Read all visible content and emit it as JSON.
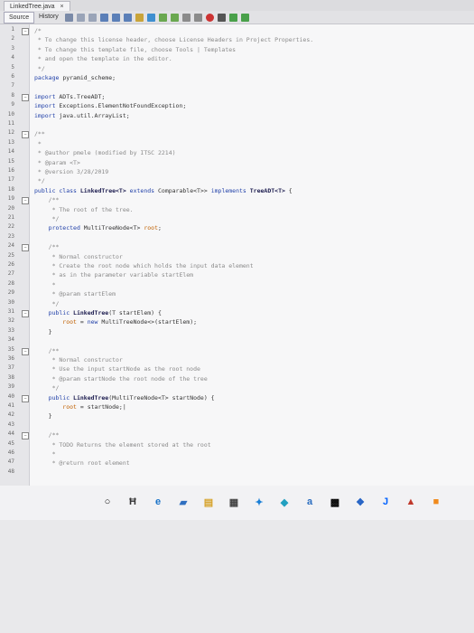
{
  "tab": {
    "title": "LinkedTree.java",
    "close": "×"
  },
  "view_tabs": [
    "Source",
    "History"
  ],
  "code_lines": [
    {
      "n": "1",
      "segs": [
        {
          "c": "cm",
          "t": "/*"
        }
      ]
    },
    {
      "n": "2",
      "segs": [
        {
          "c": "cm",
          "t": " * To change this license header, choose License Headers in Project Properties."
        }
      ]
    },
    {
      "n": "3",
      "segs": [
        {
          "c": "cm",
          "t": " * To change this template file, choose Tools | Templates"
        }
      ]
    },
    {
      "n": "4",
      "segs": [
        {
          "c": "cm",
          "t": " * and open the template in the editor."
        }
      ]
    },
    {
      "n": "5",
      "segs": [
        {
          "c": "cm",
          "t": " */"
        }
      ]
    },
    {
      "n": "6",
      "segs": [
        {
          "c": "kw",
          "t": "package"
        },
        {
          "c": "",
          "t": " pyramid_scheme;"
        }
      ]
    },
    {
      "n": "7",
      "segs": []
    },
    {
      "n": "8",
      "segs": [
        {
          "c": "kw",
          "t": "import"
        },
        {
          "c": "",
          "t": " ADTs.TreeADT;"
        }
      ]
    },
    {
      "n": "9",
      "segs": [
        {
          "c": "kw",
          "t": "import"
        },
        {
          "c": "",
          "t": " Exceptions.ElementNotFoundException;"
        }
      ]
    },
    {
      "n": "10",
      "segs": [
        {
          "c": "kw",
          "t": "import"
        },
        {
          "c": "",
          "t": " java.util.ArrayList;"
        }
      ]
    },
    {
      "n": "11",
      "segs": []
    },
    {
      "n": "12",
      "segs": [
        {
          "c": "cm",
          "t": "/**"
        }
      ]
    },
    {
      "n": "13",
      "segs": [
        {
          "c": "cm",
          "t": " *"
        }
      ]
    },
    {
      "n": "14",
      "segs": [
        {
          "c": "cm",
          "t": " * @author pmele (modified by ITSC 2214)"
        }
      ]
    },
    {
      "n": "15",
      "segs": [
        {
          "c": "cm",
          "t": " * @param <T>"
        }
      ]
    },
    {
      "n": "16",
      "segs": [
        {
          "c": "cm",
          "t": " * @version 3/28/2019"
        }
      ]
    },
    {
      "n": "17",
      "segs": [
        {
          "c": "cm",
          "t": " */"
        }
      ]
    },
    {
      "n": "18",
      "segs": [
        {
          "c": "kw",
          "t": "public class"
        },
        {
          "c": "ty",
          "t": " LinkedTree<T>"
        },
        {
          "c": "kw",
          "t": " extends"
        },
        {
          "c": "",
          "t": " Comparable<T>> "
        },
        {
          "c": "kw",
          "t": "implements"
        },
        {
          "c": "ty",
          "t": " TreeADT<T>"
        },
        {
          "c": "",
          "t": " {"
        }
      ]
    },
    {
      "n": "19",
      "segs": [
        {
          "c": "cm",
          "t": "    /**"
        }
      ]
    },
    {
      "n": "20",
      "segs": [
        {
          "c": "cm",
          "t": "     * The root of the tree."
        }
      ]
    },
    {
      "n": "21",
      "segs": [
        {
          "c": "cm",
          "t": "     */"
        }
      ]
    },
    {
      "n": "22",
      "segs": [
        {
          "c": "kw",
          "t": "    protected"
        },
        {
          "c": "",
          "t": " MultiTreeNode<T> "
        },
        {
          "c": "ps",
          "t": "root"
        },
        {
          "c": "",
          "t": ";"
        }
      ]
    },
    {
      "n": "23",
      "segs": []
    },
    {
      "n": "24",
      "segs": [
        {
          "c": "cm",
          "t": "    /**"
        }
      ]
    },
    {
      "n": "25",
      "segs": [
        {
          "c": "cm",
          "t": "     * Normal constructor"
        }
      ]
    },
    {
      "n": "26",
      "segs": [
        {
          "c": "cm",
          "t": "     * Create the root node which holds the input data element"
        }
      ]
    },
    {
      "n": "27",
      "segs": [
        {
          "c": "cm",
          "t": "     * as in the parameter variable startElem"
        }
      ]
    },
    {
      "n": "28",
      "segs": [
        {
          "c": "cm",
          "t": "     *"
        }
      ]
    },
    {
      "n": "29",
      "segs": [
        {
          "c": "cm",
          "t": "     * @param startElem"
        }
      ]
    },
    {
      "n": "30",
      "segs": [
        {
          "c": "cm",
          "t": "     */"
        }
      ]
    },
    {
      "n": "31",
      "segs": [
        {
          "c": "kw",
          "t": "    public"
        },
        {
          "c": "ty",
          "t": " LinkedTree"
        },
        {
          "c": "",
          "t": "(T startElem) {"
        }
      ]
    },
    {
      "n": "32",
      "segs": [
        {
          "c": "ps",
          "t": "        root"
        },
        {
          "c": "",
          "t": " = "
        },
        {
          "c": "kw",
          "t": "new"
        },
        {
          "c": "",
          "t": " MultiTreeNode<>(startElem);"
        }
      ]
    },
    {
      "n": "33",
      "segs": [
        {
          "c": "",
          "t": "    }"
        }
      ]
    },
    {
      "n": "34",
      "segs": []
    },
    {
      "n": "35",
      "segs": [
        {
          "c": "cm",
          "t": "    /**"
        }
      ]
    },
    {
      "n": "36",
      "segs": [
        {
          "c": "cm",
          "t": "     * Normal constructor"
        }
      ]
    },
    {
      "n": "37",
      "segs": [
        {
          "c": "cm",
          "t": "     * Use the input startNode as the root node"
        }
      ]
    },
    {
      "n": "38",
      "segs": [
        {
          "c": "cm",
          "t": "     * @param startNode the root node of the tree"
        }
      ]
    },
    {
      "n": "39",
      "segs": [
        {
          "c": "cm",
          "t": "     */"
        }
      ]
    },
    {
      "n": "40",
      "segs": [
        {
          "c": "kw",
          "t": "    public"
        },
        {
          "c": "ty",
          "t": " LinkedTree"
        },
        {
          "c": "",
          "t": "(MultiTreeNode<T> startNode) {"
        }
      ]
    },
    {
      "n": "41",
      "segs": [
        {
          "c": "ps",
          "t": "        root"
        },
        {
          "c": "",
          "t": " = startNode;|"
        }
      ]
    },
    {
      "n": "42",
      "segs": [
        {
          "c": "",
          "t": "    }"
        }
      ]
    },
    {
      "n": "43",
      "segs": []
    },
    {
      "n": "44",
      "segs": [
        {
          "c": "cm",
          "t": "    /**"
        }
      ]
    },
    {
      "n": "45",
      "segs": [
        {
          "c": "cm",
          "t": "     * TODO Returns the element stored at the root"
        }
      ]
    },
    {
      "n": "46",
      "segs": [
        {
          "c": "cm",
          "t": "     *"
        }
      ]
    },
    {
      "n": "47",
      "segs": [
        {
          "c": "cm",
          "t": "     * @return root element"
        }
      ]
    },
    {
      "n": "48",
      "segs": []
    }
  ],
  "taskbar": [
    "start-icon",
    "search-icon",
    "task-view-icon",
    "edge-icon",
    "explorer-icon",
    "calculator-icon",
    "store-icon",
    "java-icon",
    "mail-icon",
    "amazon-icon",
    "netbeans-icon",
    "dropbox-icon",
    "jgrasp-icon",
    "vlc-icon"
  ],
  "taskbar_glyphs": [
    "○",
    "Ħ",
    "e",
    "▰",
    "▤",
    "▦",
    "✦",
    "◆",
    "a",
    "▩",
    "❖",
    "J",
    "▲"
  ],
  "colors": {
    "keyword": "#1f3fa8",
    "comment": "#8a8a8a",
    "field": "#c06000",
    "editor_bg": "#f7f7f8"
  }
}
